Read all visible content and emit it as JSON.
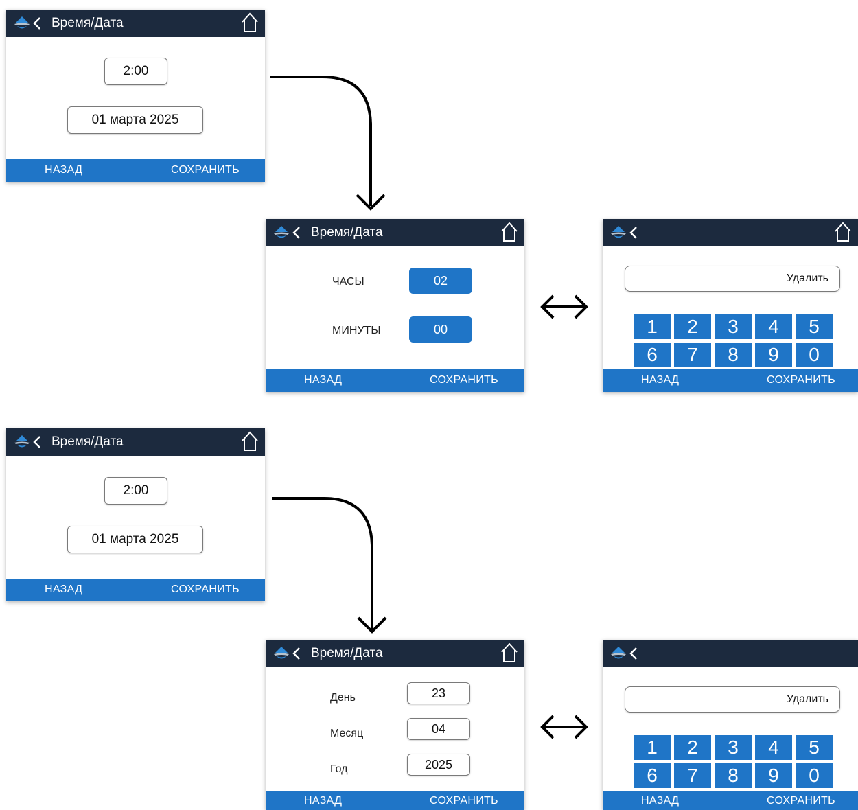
{
  "common": {
    "title": "Время/Дата",
    "back_label": "НАЗАД",
    "save_label": "СОХРАНИТЬ",
    "delete_label": "Удалить",
    "keys": [
      "1",
      "2",
      "3",
      "4",
      "5",
      "6",
      "7",
      "8",
      "9",
      "0"
    ]
  },
  "overview": {
    "time": "2:00",
    "date": "01 марта 2025"
  },
  "time_edit": {
    "hours_label": "ЧАСЫ",
    "hours_value": "02",
    "minutes_label": "МИНУТЫ",
    "minutes_value": "00"
  },
  "date_edit": {
    "day_label": "День",
    "day_value": "23",
    "month_label": "Месяц",
    "month_value": "04",
    "year_label": "Год",
    "year_value": "2025"
  },
  "colors": {
    "header": "#1c2a3e",
    "accent": "#1f75c7"
  },
  "icons": [
    "logo-icon",
    "back-chevron-icon",
    "home-icon",
    "curved-arrow-icon",
    "double-arrow-icon"
  ]
}
